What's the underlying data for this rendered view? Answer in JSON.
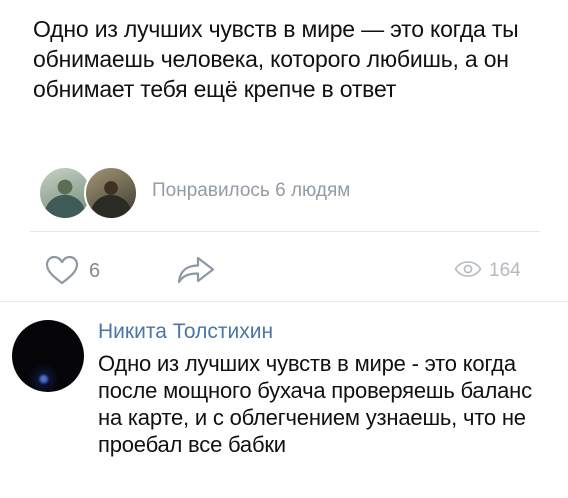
{
  "post": {
    "text": "Одно из лучших чувств в мире — это когда ты обнимаешь человека, которого любишь, а он обнимает тебя ещё крепче в ответ",
    "likes_summary": "Понравилось 6 людям",
    "like_count": "6",
    "views_count": "164"
  },
  "icons": {
    "like": "heart-outline-icon",
    "share": "share-arrow-icon",
    "views": "eye-icon"
  },
  "colors": {
    "author_link": "#4a76a8",
    "muted_text": "#939ba3"
  },
  "comment": {
    "author": "Никита Толстихин",
    "text": "Одно из лучших чувств в мире - это когда после мощного бухача проверяешь баланс на карте, и с облегчением узнаешь, что не проебал все бабки"
  }
}
